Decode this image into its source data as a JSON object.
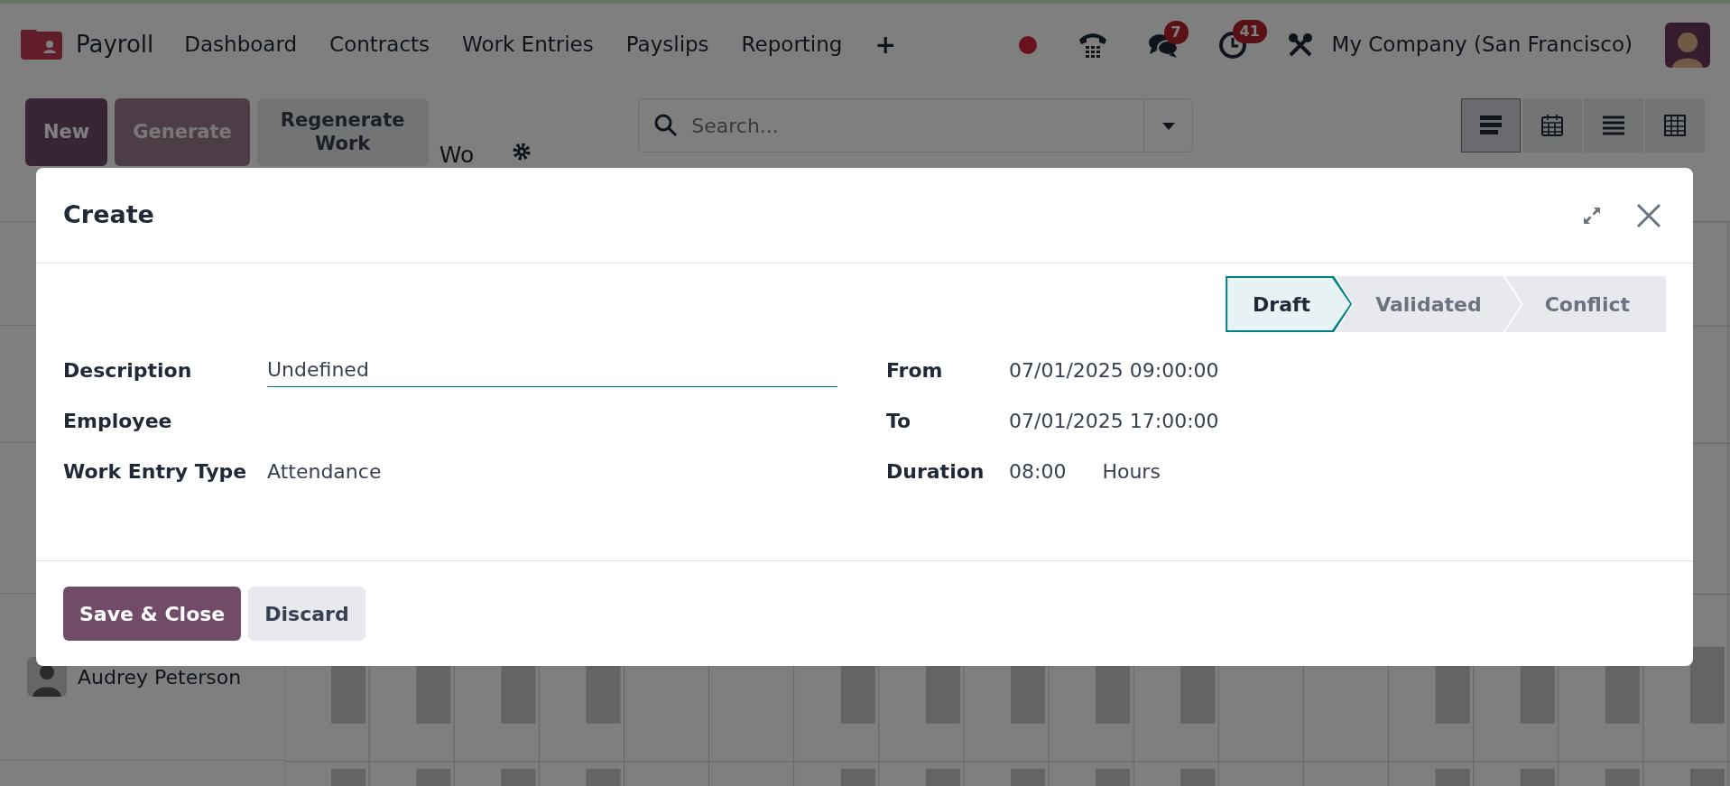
{
  "navbar": {
    "app_name": "Payroll",
    "menu": [
      "Dashboard",
      "Contracts",
      "Work Entries",
      "Payslips",
      "Reporting",
      "+"
    ],
    "chat_badge": "7",
    "activity_badge": "41",
    "company": "My Company (San Francisco)"
  },
  "control_panel": {
    "buttons": [
      {
        "label": "New",
        "kind": "primary"
      },
      {
        "label": "Generate",
        "kind": "muted"
      },
      {
        "label": "Regenerate Work",
        "kind": "light"
      }
    ],
    "title": "Wo",
    "search": {
      "placeholder": "Search..."
    },
    "views": [
      {
        "kind": "gantt",
        "selected": true
      },
      {
        "kind": "calendar",
        "selected": false
      },
      {
        "kind": "list",
        "selected": false
      },
      {
        "kind": "pivot",
        "selected": false
      }
    ]
  },
  "gantt_rows": [
    {
      "employee": "Audrey Peterson"
    }
  ],
  "dialog": {
    "title": "Create",
    "stages": [
      {
        "label": "Draft",
        "selected": true
      },
      {
        "label": "Validated",
        "selected": false
      },
      {
        "label": "Conflict",
        "selected": false
      }
    ],
    "fields_left": [
      {
        "label": "Description",
        "value": "Undefined",
        "kind": "input"
      },
      {
        "label": "Employee",
        "kind": "empty"
      },
      {
        "label": "Work Entry Type",
        "value": "Attendance",
        "kind": "text"
      }
    ],
    "fields_right": [
      {
        "label": "From",
        "value": "07/01/2025 09:00:00"
      },
      {
        "label": "To",
        "value": "07/01/2025 17:00:00"
      },
      {
        "label": "Duration",
        "value": "08:00",
        "unit": "Hours"
      }
    ],
    "buttons": [
      {
        "label": "Save & Close",
        "kind": "primary"
      },
      {
        "label": "Discard",
        "kind": "secondary"
      }
    ]
  }
}
